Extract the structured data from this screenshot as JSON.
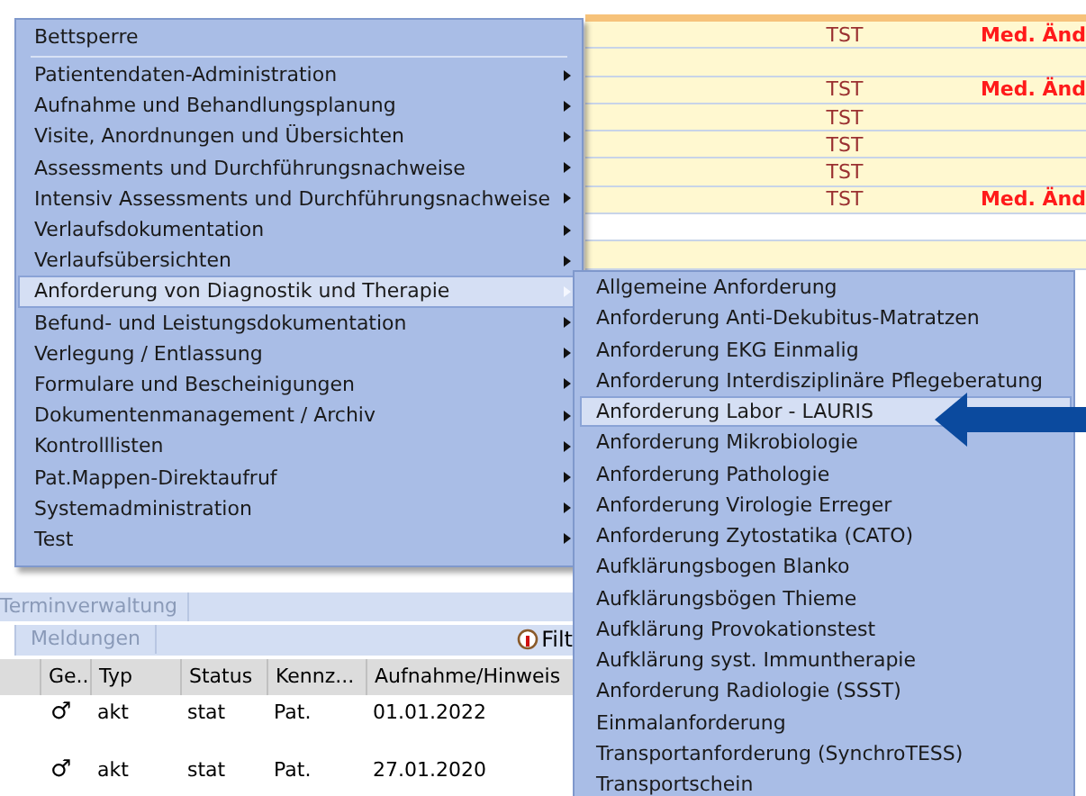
{
  "record_table": {
    "rows": [
      {
        "column_1": "TST",
        "column_2": "Med. Änd",
        "shaded": true
      },
      {
        "shaded": true
      },
      {
        "column_1": "TST",
        "column_2": "Med. Änd",
        "shaded": true
      },
      {
        "column_1": "TST",
        "shaded": true
      },
      {
        "column_1": "TST",
        "shaded": true
      },
      {
        "column_1": "TST",
        "shaded": true
      },
      {
        "column_1": "TST",
        "column_2": "Med. Änd",
        "shaded": true
      },
      {
        "shaded": false
      },
      {
        "shaded": true
      }
    ]
  },
  "bottom_panel": {
    "tab": "Terminverwaltung",
    "subtab": "Meldungen",
    "filter": "Filt",
    "columns": [
      "Ge..",
      "Typ",
      "Status",
      "Kennz...",
      "Aufnahme/Hinweis"
    ],
    "rows": [
      {
        "gender": "♂",
        "typ": "akt",
        "status": "stat",
        "kennz": "Pat.",
        "aufnahme": "01.01.2022"
      },
      {
        "gender": "♂",
        "typ": "akt",
        "status": "stat",
        "kennz": "Pat.",
        "aufnahme": "27.01.2020"
      }
    ]
  },
  "context_menu": {
    "items": [
      {
        "label": "Bettsperre",
        "kind": "plain",
        "selected": false
      },
      {
        "kind": "separator"
      },
      {
        "label": "Patientendaten-Administration",
        "kind": "submenu",
        "selected": false
      },
      {
        "label": "Aufnahme und Behandlungsplanung",
        "kind": "submenu",
        "selected": false
      },
      {
        "label": "Visite, Anordnungen und Übersichten",
        "kind": "submenu",
        "selected": false
      },
      {
        "label": "Assessments und Durchführungsnachweise",
        "kind": "submenu",
        "selected": false
      },
      {
        "label": "Intensiv Assessments und Durchführungsnachweise",
        "kind": "submenu",
        "selected": false
      },
      {
        "label": "Verlaufsdokumentation",
        "kind": "submenu",
        "selected": false
      },
      {
        "label": "Verlaufsübersichten",
        "kind": "submenu",
        "selected": false
      },
      {
        "label": "Anforderung von Diagnostik und Therapie",
        "kind": "submenu",
        "selected": true
      },
      {
        "label": "Befund- und Leistungsdokumentation",
        "kind": "submenu",
        "selected": false
      },
      {
        "label": "Verlegung / Entlassung",
        "kind": "submenu",
        "selected": false
      },
      {
        "label": "Formulare und Bescheinigungen",
        "kind": "submenu",
        "selected": false
      },
      {
        "label": "Dokumentenmanagement / Archiv",
        "kind": "submenu",
        "selected": false
      },
      {
        "label": "Kontrolllisten",
        "kind": "submenu",
        "selected": false
      },
      {
        "label": "Pat.Mappen-Direktaufruf",
        "kind": "submenu",
        "selected": false
      },
      {
        "label": "Systemadministration",
        "kind": "submenu",
        "selected": false
      },
      {
        "label": "Test",
        "kind": "submenu",
        "selected": false
      }
    ]
  },
  "submenu": {
    "items": [
      {
        "label": "Allgemeine Anforderung",
        "kind": "plain",
        "selected": false
      },
      {
        "label": "Anforderung Anti-Dekubitus-Matratzen",
        "kind": "plain",
        "selected": false
      },
      {
        "label": "Anforderung EKG Einmalig",
        "kind": "plain",
        "selected": false
      },
      {
        "label": "Anforderung Interdisziplinäre Pflegeberatung",
        "kind": "plain",
        "selected": false
      },
      {
        "label": "Anforderung Labor - LAURIS",
        "kind": "plain",
        "selected": true
      },
      {
        "label": "Anforderung Mikrobiologie",
        "kind": "plain",
        "selected": false
      },
      {
        "label": "Anforderung Pathologie",
        "kind": "plain",
        "selected": false
      },
      {
        "label": "Anforderung Virologie Erreger",
        "kind": "plain",
        "selected": false
      },
      {
        "label": "Anforderung Zytostatika (CATO)",
        "kind": "plain",
        "selected": false
      },
      {
        "label": "Aufklärungsbogen Blanko",
        "kind": "plain",
        "selected": false
      },
      {
        "label": "Aufklärungsbögen Thieme",
        "kind": "plain",
        "selected": false
      },
      {
        "label": "Aufklärung Provokationstest",
        "kind": "plain",
        "selected": false
      },
      {
        "label": "Aufklärung syst. Immuntherapie",
        "kind": "plain",
        "selected": false
      },
      {
        "label": "Anforderung Radiologie (SSST)",
        "kind": "plain",
        "selected": false
      },
      {
        "label": "Einmalanforderung",
        "kind": "plain",
        "selected": false
      },
      {
        "label": "Transportanforderung (SynchroTESS)",
        "kind": "plain",
        "selected": false
      },
      {
        "label": "Transportschein",
        "kind": "plain",
        "selected": false
      }
    ]
  }
}
